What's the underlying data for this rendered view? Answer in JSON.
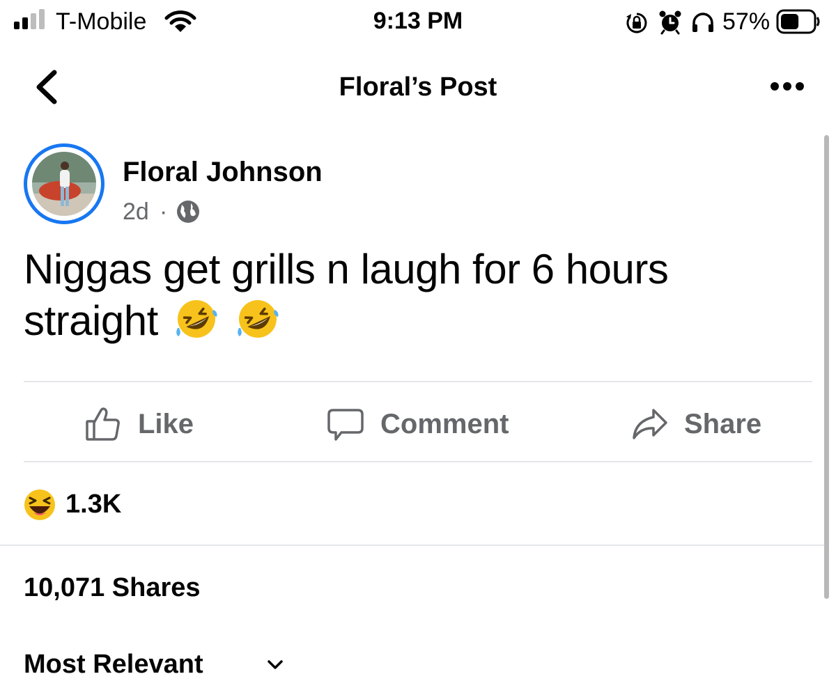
{
  "status_bar": {
    "carrier": "T-Mobile",
    "time": "9:13 PM",
    "battery_percent": "57%",
    "signal_bars_filled": 2,
    "signal_bars_total": 4,
    "battery_level": 0.57,
    "icons": [
      "signal-icon",
      "wifi-icon",
      "orientation-lock-icon",
      "alarm-icon",
      "headphones-icon",
      "battery-icon"
    ]
  },
  "nav": {
    "title": "Floral’s Post",
    "back_icon": "chevron-left-icon",
    "more_icon": "ellipsis-icon"
  },
  "post": {
    "author": "Floral Johnson",
    "time": "2d",
    "separator": "·",
    "privacy_icon": "globe-icon",
    "text": "Niggas get grills n laugh for 6 hours straight",
    "text_emojis": [
      "rofl-emoji",
      "rofl-emoji"
    ]
  },
  "actions": {
    "like": "Like",
    "comment": "Comment",
    "share": "Share"
  },
  "reactions": {
    "icon": "haha-reaction-icon",
    "count": "1.3K"
  },
  "shares": {
    "label": "10,071 Shares"
  },
  "comments_sort": {
    "label": "Most Relevant",
    "icon": "chevron-down-icon"
  },
  "colors": {
    "accent": "#1877f2",
    "secondary_text": "#65676b",
    "divider": "#e4e6eb"
  }
}
